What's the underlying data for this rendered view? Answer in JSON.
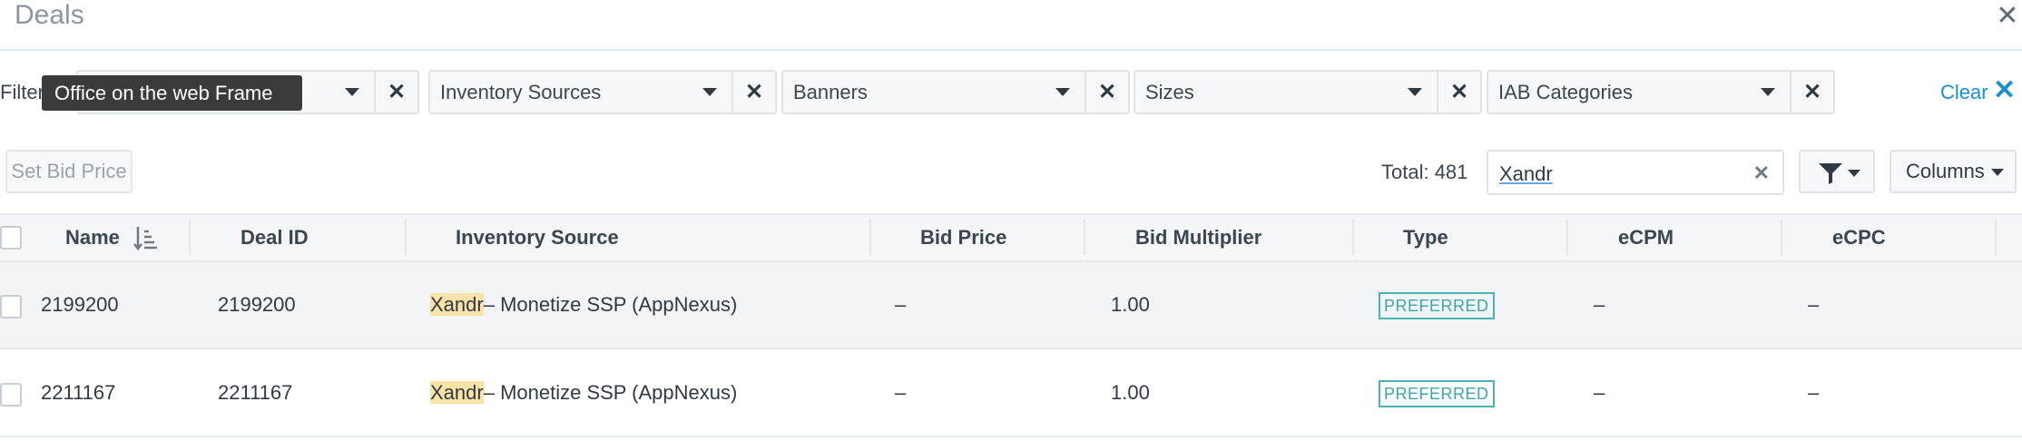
{
  "header": {
    "title": "Deals",
    "close_icon": "close-icon"
  },
  "filters": {
    "label": "Filter",
    "tooltip": "Office on the web Frame",
    "items": [
      {
        "label": ""
      },
      {
        "label": "Inventory Sources"
      },
      {
        "label": "Banners"
      },
      {
        "label": "Sizes"
      },
      {
        "label": "IAB Categories"
      }
    ],
    "clear_symbol": "✕",
    "clear_all_label": "Clear"
  },
  "toolbar": {
    "set_bid_price_label": "Set Bid Price",
    "total_label": "Total: 481",
    "search_value": "Xandr",
    "funnel_icon": "funnel-icon",
    "columns_label": "Columns"
  },
  "table": {
    "columns": [
      "Name",
      "Deal ID",
      "Inventory Source",
      "Bid Price",
      "Bid Multiplier",
      "Type",
      "eCPM",
      "eCPC"
    ],
    "rows": [
      {
        "name": "2199200",
        "deal_id": "2199200",
        "source_highlight": "Xandr",
        "source_rest": "– Monetize SSP (AppNexus)",
        "bid_price": "–",
        "bid_multiplier": "1.00",
        "type": "PREFERRED",
        "ecpm": "–",
        "ecpc": "–"
      },
      {
        "name": "2211167",
        "deal_id": "2211167",
        "source_highlight": "Xandr",
        "source_rest": "– Monetize SSP (AppNexus)",
        "bid_price": "–",
        "bid_multiplier": "1.00",
        "type": "PREFERRED",
        "ecpm": "–",
        "ecpc": "–"
      }
    ]
  },
  "colors": {
    "accent": "#1b8fd3",
    "badge": "#3aa8aa",
    "highlight": "#fbe2a7"
  }
}
